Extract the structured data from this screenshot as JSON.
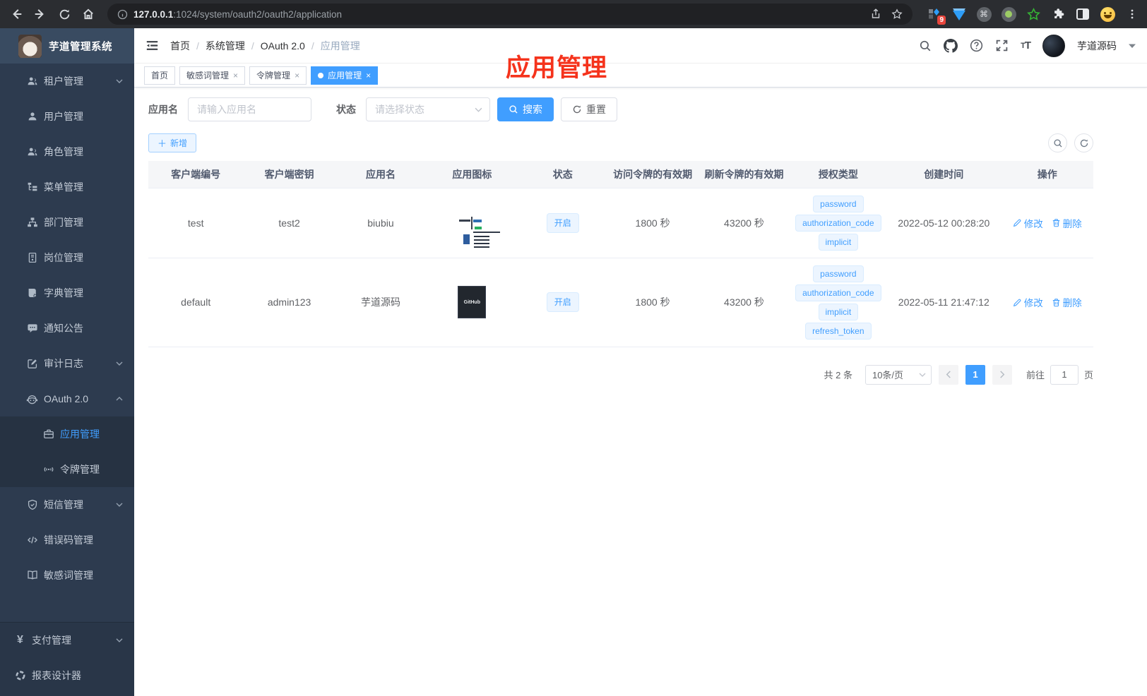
{
  "browser": {
    "url_host": "127.0.0.1",
    "url_path": ":1024/system/oauth2/oauth2/application",
    "extension_badge": "9"
  },
  "sidebar": {
    "logo_title": "芋道管理系统",
    "menu": [
      {
        "label": "租户管理",
        "icon": "tenant-users-icon"
      },
      {
        "label": "用户管理",
        "icon": "user-icon"
      },
      {
        "label": "角色管理",
        "icon": "roles-icon"
      },
      {
        "label": "菜单管理",
        "icon": "menu-tree-icon"
      },
      {
        "label": "部门管理",
        "icon": "org-chart-icon"
      },
      {
        "label": "岗位管理",
        "icon": "post-badge-icon"
      },
      {
        "label": "字典管理",
        "icon": "dictionary-icon"
      },
      {
        "label": "通知公告",
        "icon": "announcement-icon"
      },
      {
        "label": "审计日志",
        "icon": "audit-log-icon"
      },
      {
        "label": "OAuth 2.0",
        "icon": "oauth-robot-icon"
      },
      {
        "label": "应用管理",
        "icon": "application-briefcase-icon"
      },
      {
        "label": "令牌管理",
        "icon": "token-signal-icon"
      },
      {
        "label": "短信管理",
        "icon": "sms-shield-icon"
      },
      {
        "label": "错误码管理",
        "icon": "error-code-icon"
      },
      {
        "label": "敏感词管理",
        "icon": "sensitive-word-book-icon"
      },
      {
        "label": "支付管理",
        "icon": "payment-yen-icon"
      },
      {
        "label": "报表设计器",
        "icon": "report-designer-icon"
      }
    ]
  },
  "navbar": {
    "breadcrumb": [
      "首页",
      "系统管理",
      "OAuth 2.0",
      "应用管理"
    ],
    "username": "芋道源码"
  },
  "tabbar": {
    "tabs": [
      {
        "label": "首页"
      },
      {
        "label": "敏感词管理"
      },
      {
        "label": "令牌管理"
      },
      {
        "label": "应用管理"
      }
    ]
  },
  "annotation": {
    "text": "应用管理",
    "color": "#f5331c"
  },
  "filters": {
    "name_label": "应用名",
    "name_placeholder": "请输入应用名",
    "status_label": "状态",
    "status_placeholder": "请选择状态",
    "search_label": "搜索",
    "reset_label": "重置"
  },
  "toolbar": {
    "add_label": "新增"
  },
  "table": {
    "columns": [
      "客户端编号",
      "客户端密钥",
      "应用名",
      "应用图标",
      "状态",
      "访问令牌的有效期",
      "刷新令牌的有效期",
      "授权类型",
      "创建时间",
      "操作"
    ],
    "rows": [
      {
        "client_id": "test",
        "secret": "test2",
        "name": "biubiu",
        "icon": "dark-dashboard-screenshot",
        "status": "开启",
        "access_validity": "1800 秒",
        "refresh_validity": "43200 秒",
        "grants": [
          "password",
          "authorization_code",
          "implicit"
        ],
        "created": "2022-05-12 00:28:20"
      },
      {
        "client_id": "default",
        "secret": "admin123",
        "name": "芋道源码",
        "icon": "github-dark-logo",
        "icon_text": "GitHub",
        "status": "开启",
        "access_validity": "1800 秒",
        "refresh_validity": "43200 秒",
        "grants": [
          "password",
          "authorization_code",
          "implicit",
          "refresh_token"
        ],
        "created": "2022-05-11 21:47:12"
      }
    ],
    "actions": {
      "edit": "修改",
      "delete": "删除"
    }
  },
  "pagination": {
    "total_label": "共 2 条",
    "page_size_label": "10条/页",
    "page": "1",
    "goto_label": "前往",
    "goto_value": "1",
    "unit_label": "页"
  }
}
